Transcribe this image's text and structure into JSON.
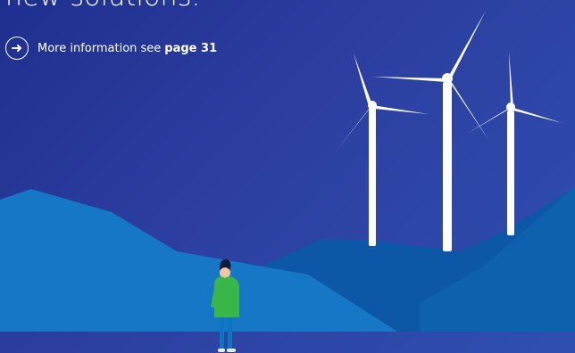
{
  "heading": {
    "text": "new solutions."
  },
  "info": {
    "prefix": "More information see",
    "link": "page 31"
  },
  "icons": {
    "info_arrow": "arrow-right-circle-icon"
  },
  "colors": {
    "bg_dark": "#1f2f8f",
    "bg_mid": "#2c3fa0",
    "bg_light": "#2f4fb0",
    "hill_front": "#1677c7",
    "hill_back": "#0b5aa6",
    "hill_right_dark": "#0f63ad",
    "turbine_white": "#ffffff",
    "person_hoodie": "#39b54a",
    "person_pants": "#0b76c0",
    "person_hair": "#101a3a"
  }
}
